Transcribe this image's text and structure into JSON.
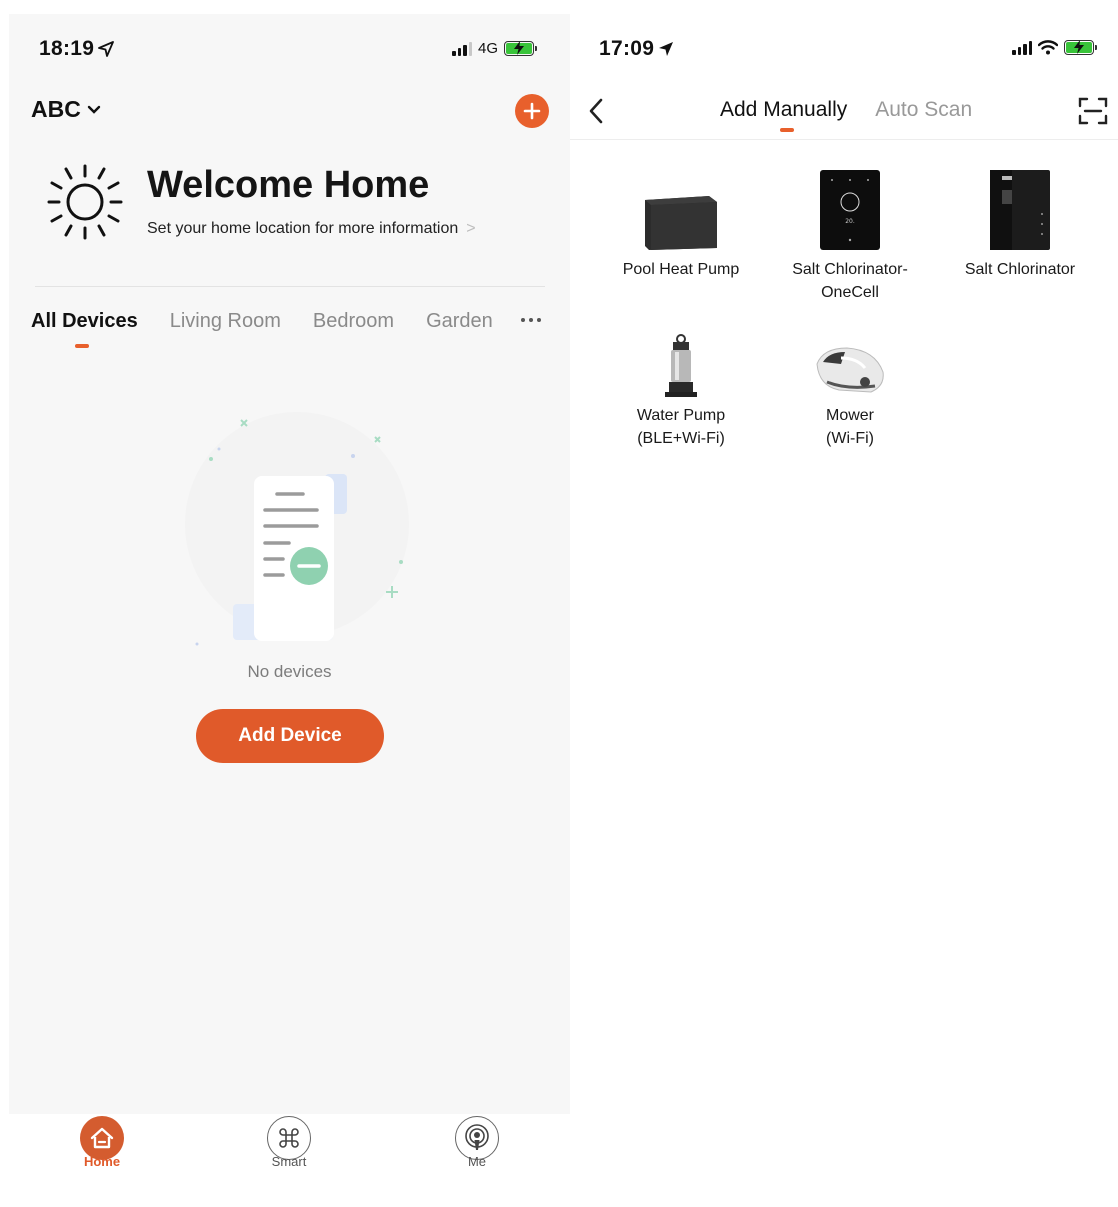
{
  "left_screen": {
    "status": {
      "time": "18:19",
      "network": "4G"
    },
    "header": {
      "home_name": "ABC"
    },
    "welcome": {
      "title": "Welcome Home",
      "subtitle": "Set your home location for more information",
      "chevron": ">"
    },
    "tabs": [
      "All Devices",
      "Living Room",
      "Bedroom",
      "Garden"
    ],
    "empty_state": {
      "message": "No devices",
      "button": "Add Device"
    },
    "tabbar": {
      "home": "Home",
      "smart": "Smart",
      "me": "Me"
    }
  },
  "right_screen": {
    "status": {
      "time": "17:09"
    },
    "tabs": {
      "manual": "Add Manually",
      "auto": "Auto Scan"
    },
    "devices": [
      {
        "line1": "Pool Heat Pump",
        "line2": ""
      },
      {
        "line1": "Salt Chlorinator-",
        "line2": "OneCell"
      },
      {
        "line1": "Salt Chlorinator",
        "line2": ""
      },
      {
        "line1": "Water Pump",
        "line2": "(BLE+Wi-Fi)"
      },
      {
        "line1": "Mower",
        "line2": "(Wi-Fi)"
      }
    ]
  },
  "colors": {
    "accent": "#e8602c",
    "battery": "#39c43a"
  },
  "icons": [
    "location-arrow-icon",
    "signal-icon",
    "battery-icon",
    "chevron-down-icon",
    "plus-icon",
    "sun-icon",
    "more-dots-icon",
    "home-icon",
    "command-icon",
    "podcast-icon",
    "back-chevron-icon",
    "scan-icon",
    "wifi-icon"
  ]
}
